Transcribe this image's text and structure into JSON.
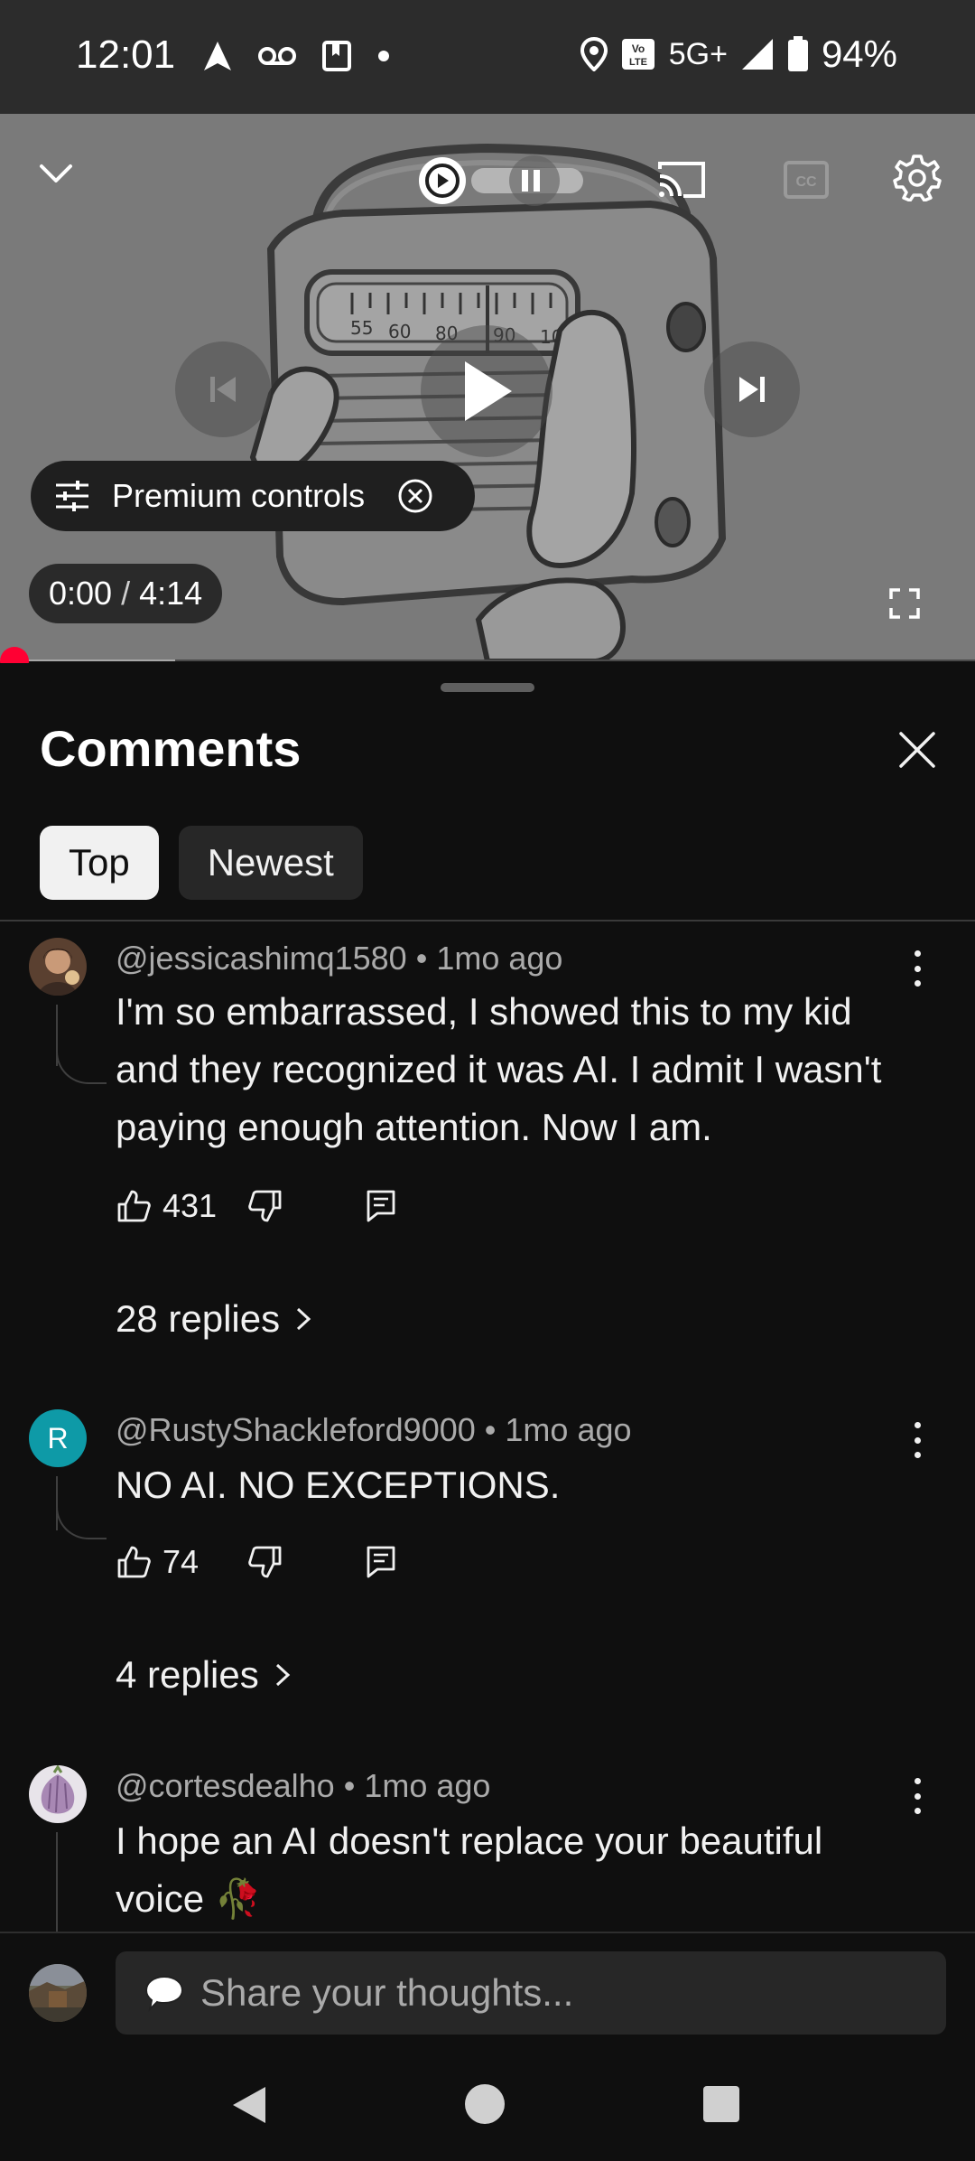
{
  "status_bar": {
    "time": "12:01",
    "network": "5G+",
    "battery": "94%",
    "icons": [
      "navigation-icon",
      "voicemail-icon",
      "book-icon",
      "dot-icon",
      "location-icon",
      "volte-icon",
      "signal-icon",
      "battery-icon"
    ]
  },
  "player": {
    "premium_controls_label": "Premium controls",
    "current_time": "0:00",
    "separator": "/",
    "duration": "4:14",
    "progress_fraction": 0.0,
    "buffer_fraction": 0.18
  },
  "comments_panel": {
    "title": "Comments",
    "tabs": [
      {
        "label": "Top",
        "active": true
      },
      {
        "label": "Newest",
        "active": false
      }
    ],
    "comments": [
      {
        "author": "@jessicashimq1580",
        "time_ago": "1mo ago",
        "text": "I'm so embarrassed, I showed this to my kid and they recognized it was AI. I admit I wasn't paying enough attention. Now I am.",
        "likes": "431",
        "replies": "28 replies"
      },
      {
        "author": "@RustyShackleford9000",
        "avatar_letter": "R",
        "avatar_color": "#0e9aa7",
        "time_ago": "1mo ago",
        "text": "NO AI. NO EXCEPTIONS.",
        "likes": "74",
        "replies": "4 replies"
      },
      {
        "author": "@cortesdealho",
        "time_ago": "1mo ago",
        "text": "I hope an AI doesn't replace your beautiful voice 🥀"
      }
    ],
    "meta_separator": "•",
    "input_placeholder": "Share your thoughts..."
  },
  "colors": {
    "accent_red": "#ff0033",
    "background": "#0f0f0f",
    "chip_inactive": "#272727"
  }
}
